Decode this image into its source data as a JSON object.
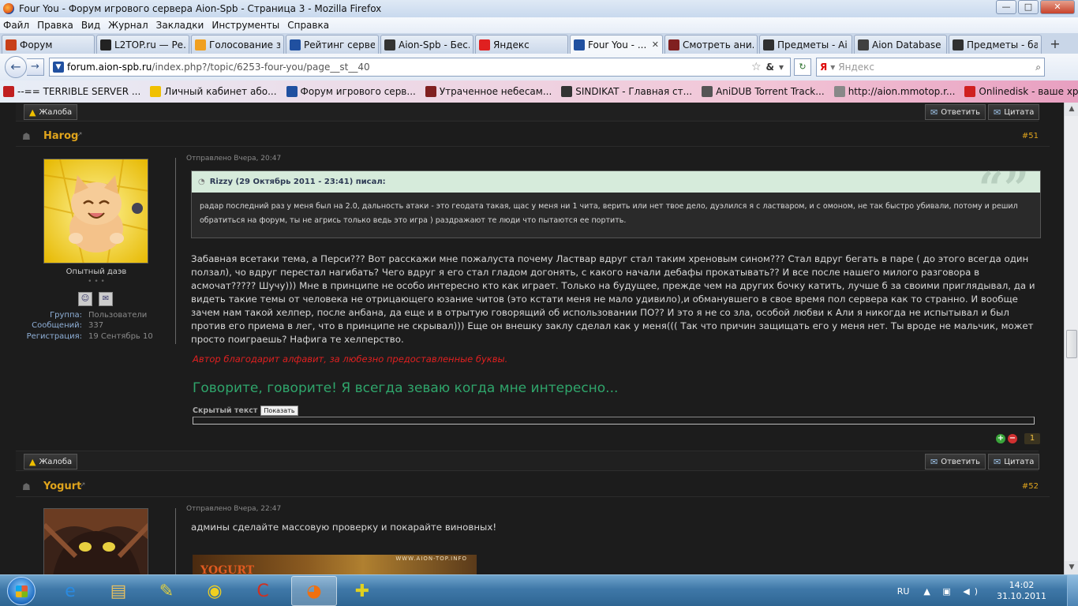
{
  "window": {
    "title": "Four You - Форум игрового сервера Aion-Spb - Страница 3 - Mozilla Firefox",
    "controls": {
      "minimize": "—",
      "maximize": "□",
      "close": "✕"
    }
  },
  "menu": [
    "Файл",
    "Правка",
    "Вид",
    "Журнал",
    "Закладки",
    "Инструменты",
    "Справка"
  ],
  "tabs": [
    {
      "label": "Форум",
      "icon": "scroll-icon",
      "color": "#c8401a"
    },
    {
      "label": "L2TOP.ru — Ре...",
      "icon": "l2top-icon",
      "color": "#222222"
    },
    {
      "label": "Голосование з...",
      "icon": "vote-icon",
      "color": "#f0a020"
    },
    {
      "label": "Рейтинг серве...",
      "icon": "aion-wings-icon",
      "color": "#2050a0"
    },
    {
      "label": "Aion-Spb - Бес...",
      "icon": "aion-spb-icon",
      "color": "#333333"
    },
    {
      "label": "Яндекс",
      "icon": "yandex-icon",
      "color": "#e02020"
    },
    {
      "label": "Four You - ...",
      "icon": "aion-wings-icon",
      "color": "#2050a0",
      "active": true
    },
    {
      "label": "Смотреть ани...",
      "icon": "anime-icon",
      "color": "#802020"
    },
    {
      "label": "Предметы - Ai...",
      "icon": "aion-a-icon",
      "color": "#303030"
    },
    {
      "label": "Aion Database ...",
      "icon": "aion-db-icon",
      "color": "#404040"
    },
    {
      "label": "Предметы - ба...",
      "icon": "aion-a-icon",
      "color": "#303030"
    }
  ],
  "tab_close": "✕",
  "new_tab": "+",
  "nav": {
    "url_host": "forum.aion-spb.ru",
    "url_path": "/index.php?/topic/6253-four-you/page__st__40",
    "url_scheme": "",
    "search_placeholder": "Яндекс",
    "search_brand": "Я"
  },
  "bookmarks": [
    {
      "label": "--== TERRIBLE SERVER ...",
      "icon": "red-flag-icon",
      "color": "#c02020"
    },
    {
      "label": "Личный кабинет або...",
      "icon": "beeline-icon",
      "color": "#f0c000"
    },
    {
      "label": "Форум игрового серв...",
      "icon": "aion-wings-icon",
      "color": "#2050a0"
    },
    {
      "label": "Утраченное небесам...",
      "icon": "game-icon",
      "color": "#802020"
    },
    {
      "label": "SINDIKAT - Главная ст...",
      "icon": "figure-icon",
      "color": "#333333"
    },
    {
      "label": "AniDUB Torrent Track...",
      "icon": "fish-icon",
      "color": "#555555"
    },
    {
      "label": "http://aion.mmotop.r...",
      "icon": "wings-icon",
      "color": "#888888"
    },
    {
      "label": "Onlinedisk - ваше хра...",
      "icon": "onlinedisk-icon",
      "color": "#d02020"
    }
  ],
  "post_buttons": {
    "report": "Жалоба",
    "reply": "Ответить",
    "quote": "Цитата"
  },
  "posts": [
    {
      "author": "Harog",
      "number": "#51",
      "sent": "Отправлено Вчера, 20:47",
      "rank": "Опытный даэв",
      "pips": "• • •",
      "fields": [
        {
          "key": "Группа:",
          "value": "Пользователи"
        },
        {
          "key": "Сообщений:",
          "value": "337"
        },
        {
          "key": "Регистрация:",
          "value": "19 Сентябрь 10"
        }
      ],
      "quote": {
        "header": "Rizzy (29 Октябрь 2011 - 23:41) писал:",
        "text": "радар последний раз у меня был на 2.0, дальность атаки - это геодата такая, щас у меня ни 1 чита, верить или нет твое дело, дуэлился я с ластваром, и с омоном, не так быстро убивали, потому и решил обратиться на форум, ты не агрись только ведь это игра ) раздражают те люди что пытаются ее портить."
      },
      "body": "Забавная всетаки тема, а Перси??? Вот расскажи мне пожалуста почему Ластвар вдруг стал таким хреновым сином??? Стал вдруг бегать в паре ( до этого всегда один ползал), чо вдруг перестал нагибать? Чего вдруг я его стал гладом догонять, с какого начали дебафы прокатывать?? И все после нашего милого разговора в асмочат????? Шучу))) Мне в принципе не особо интересно кто как играет. Только на будущее, прежде чем на других бочку катить, лучше б за своими приглядывал, да и видеть такие темы от человека не отрицающего юзание читов (это кстати меня не мало удивило),и обманувшего в свое время пол сервера как то странно. И вообще зачем нам такой хелпер, после анбана, да еще и в отрытую говорящий об использовании ПО?? И это я не со зла, особой любви к Али я никогда не испытывал и был против его приема в лег, что в принципе не скрывал))) Еще он внешку заклу сделал как у меня((( Так что причин защищать его у меня нет. Ты вроде не мальчик, может просто поиграешь? Нафига те хелперство.",
      "sig_red": "Автор благодарит алфавит, за любезно предоставленные буквы.",
      "sig_green": "Говорите, говорите! Я всегда зеваю когда мне интересно...",
      "hidden_label": "Скрытый текст",
      "hidden_button": "Показать",
      "reputation": "1"
    },
    {
      "author": "Yogurt",
      "number": "#52",
      "sent": "Отправлено Вчера, 22:47",
      "body": "админы сделайте массовую проверку и покарайте виновных!",
      "sig_image_text": "YOGURT",
      "sig_image_url": "WWW.AION-TOP.INFO"
    }
  ],
  "taskbar": {
    "apps": [
      {
        "name": "internet-explorer-icon",
        "glyph": "e",
        "color": "#2a8ae0"
      },
      {
        "name": "file-explorer-icon",
        "glyph": "▤",
        "color": "#e8c060"
      },
      {
        "name": "paint-tools-icon",
        "glyph": "✎",
        "color": "#e0d040"
      },
      {
        "name": "media-player-icon",
        "glyph": "◉",
        "color": "#f0d020"
      },
      {
        "name": "ccleaner-icon",
        "glyph": "C",
        "color": "#d03020"
      },
      {
        "name": "firefox-icon",
        "glyph": "◕",
        "color": "#f07010",
        "active": true
      },
      {
        "name": "game-launcher-icon",
        "glyph": "✚",
        "color": "#e0d020"
      }
    ],
    "lang": "RU",
    "tray": "▲ ▣ ◀)",
    "time": "14:02",
    "date": "31.10.2011"
  }
}
